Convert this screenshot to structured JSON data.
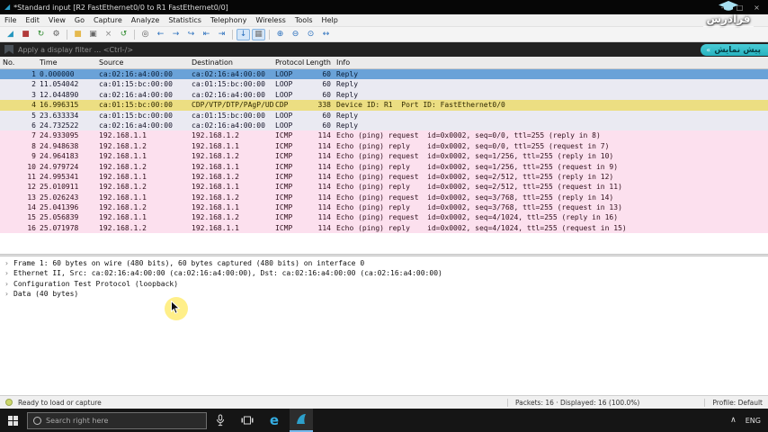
{
  "window": {
    "title": "*Standard input [R2 FastEthernet0/0 to R1 FastEthernet0/0]",
    "controls": [
      "–",
      "□",
      "×"
    ]
  },
  "menu": {
    "items": [
      "File",
      "Edit",
      "View",
      "Go",
      "Capture",
      "Analyze",
      "Statistics",
      "Telephony",
      "Wireless",
      "Tools",
      "Help"
    ]
  },
  "toolbar": {
    "icons": [
      {
        "name": "start-capture-icon",
        "glyph": "◢",
        "color": "#2596be"
      },
      {
        "name": "stop-capture-icon",
        "glyph": "■",
        "color": "#b23b3b"
      },
      {
        "name": "restart-capture-icon",
        "glyph": "↻",
        "color": "#2e8b2e"
      },
      {
        "name": "capture-options-icon",
        "glyph": "⚙",
        "color": "#5a5a5a"
      },
      {
        "sep": true
      },
      {
        "name": "open-file-icon",
        "glyph": "■",
        "color": "#e5b94e"
      },
      {
        "name": "save-file-icon",
        "glyph": "▣",
        "color": "#666666"
      },
      {
        "name": "close-file-icon",
        "glyph": "×",
        "color": "#888888"
      },
      {
        "name": "reload-file-icon",
        "glyph": "↺",
        "color": "#2e8b2e"
      },
      {
        "sep": true
      },
      {
        "name": "find-packet-icon",
        "glyph": "◎",
        "color": "#555555"
      },
      {
        "name": "back-icon",
        "glyph": "←",
        "color": "#2a6fbd"
      },
      {
        "name": "forward-icon",
        "glyph": "→",
        "color": "#2a6fbd"
      },
      {
        "name": "goto-packet-icon",
        "glyph": "↪",
        "color": "#2a6fbd"
      },
      {
        "name": "first-packet-icon",
        "glyph": "⇤",
        "color": "#2a6fbd"
      },
      {
        "name": "last-packet-icon",
        "glyph": "⇥",
        "color": "#2a6fbd"
      },
      {
        "sep": true
      },
      {
        "name": "auto-scroll-icon",
        "glyph": "↓",
        "color": "#2a6fbd",
        "active": true
      },
      {
        "name": "colorize-icon",
        "glyph": "▦",
        "color": "#777777",
        "active": true
      },
      {
        "sep": true
      },
      {
        "name": "zoom-in-icon",
        "glyph": "⊕",
        "color": "#2a6fbd"
      },
      {
        "name": "zoom-out-icon",
        "glyph": "⊖",
        "color": "#2a6fbd"
      },
      {
        "name": "zoom-reset-icon",
        "glyph": "⊙",
        "color": "#2a6fbd"
      },
      {
        "name": "resize-columns-icon",
        "glyph": "↔",
        "color": "#2a6fbd"
      }
    ]
  },
  "filter": {
    "placeholder": "Apply a display filter ... <Ctrl-/>"
  },
  "watermark": {
    "brand": "فرادرس",
    "badge": "پیش نمایش",
    "badge_mark": "«"
  },
  "packet_list": {
    "columns": [
      "No.",
      "Time",
      "Source",
      "Destination",
      "Protocol",
      "Length",
      "Info"
    ],
    "rows": [
      {
        "no": "1",
        "time": "0.000000",
        "source": "ca:02:16:a4:00:00",
        "destination": "ca:02:16:a4:00:00",
        "protocol": "LOOP",
        "length": "60",
        "info": "Reply",
        "type": "selected"
      },
      {
        "no": "2",
        "time": "11.054042",
        "source": "ca:01:15:bc:00:00",
        "destination": "ca:01:15:bc:00:00",
        "protocol": "LOOP",
        "length": "60",
        "info": "Reply",
        "type": "loop"
      },
      {
        "no": "3",
        "time": "12.044890",
        "source": "ca:02:16:a4:00:00",
        "destination": "ca:02:16:a4:00:00",
        "protocol": "LOOP",
        "length": "60",
        "info": "Reply",
        "type": "loop"
      },
      {
        "no": "4",
        "time": "16.996315",
        "source": "ca:01:15:bc:00:00",
        "destination": "CDP/VTP/DTP/PAgP/UD..",
        "protocol": "CDP",
        "length": "338",
        "info": "Device ID: R1  Port ID: FastEthernet0/0",
        "type": "cdp"
      },
      {
        "no": "5",
        "time": "23.633334",
        "source": "ca:01:15:bc:00:00",
        "destination": "ca:01:15:bc:00:00",
        "protocol": "LOOP",
        "length": "60",
        "info": "Reply",
        "type": "loop"
      },
      {
        "no": "6",
        "time": "24.732522",
        "source": "ca:02:16:a4:00:00",
        "destination": "ca:02:16:a4:00:00",
        "protocol": "LOOP",
        "length": "60",
        "info": "Reply",
        "type": "loop"
      },
      {
        "no": "7",
        "time": "24.933095",
        "source": "192.168.1.1",
        "destination": "192.168.1.2",
        "protocol": "ICMP",
        "length": "114",
        "info": "Echo (ping) request  id=0x0002, seq=0/0, ttl=255 (reply in 8)",
        "type": "icmp"
      },
      {
        "no": "8",
        "time": "24.948638",
        "source": "192.168.1.2",
        "destination": "192.168.1.1",
        "protocol": "ICMP",
        "length": "114",
        "info": "Echo (ping) reply    id=0x0002, seq=0/0, ttl=255 (request in 7)",
        "type": "icmp"
      },
      {
        "no": "9",
        "time": "24.964183",
        "source": "192.168.1.1",
        "destination": "192.168.1.2",
        "protocol": "ICMP",
        "length": "114",
        "info": "Echo (ping) request  id=0x0002, seq=1/256, ttl=255 (reply in 10)",
        "type": "icmp"
      },
      {
        "no": "10",
        "time": "24.979724",
        "source": "192.168.1.2",
        "destination": "192.168.1.1",
        "protocol": "ICMP",
        "length": "114",
        "info": "Echo (ping) reply    id=0x0002, seq=1/256, ttl=255 (request in 9)",
        "type": "icmp"
      },
      {
        "no": "11",
        "time": "24.995341",
        "source": "192.168.1.1",
        "destination": "192.168.1.2",
        "protocol": "ICMP",
        "length": "114",
        "info": "Echo (ping) request  id=0x0002, seq=2/512, ttl=255 (reply in 12)",
        "type": "icmp"
      },
      {
        "no": "12",
        "time": "25.010911",
        "source": "192.168.1.2",
        "destination": "192.168.1.1",
        "protocol": "ICMP",
        "length": "114",
        "info": "Echo (ping) reply    id=0x0002, seq=2/512, ttl=255 (request in 11)",
        "type": "icmp"
      },
      {
        "no": "13",
        "time": "25.026243",
        "source": "192.168.1.1",
        "destination": "192.168.1.2",
        "protocol": "ICMP",
        "length": "114",
        "info": "Echo (ping) request  id=0x0002, seq=3/768, ttl=255 (reply in 14)",
        "type": "icmp"
      },
      {
        "no": "14",
        "time": "25.041396",
        "source": "192.168.1.2",
        "destination": "192.168.1.1",
        "protocol": "ICMP",
        "length": "114",
        "info": "Echo (ping) reply    id=0x0002, seq=3/768, ttl=255 (request in 13)",
        "type": "icmp"
      },
      {
        "no": "15",
        "time": "25.056839",
        "source": "192.168.1.1",
        "destination": "192.168.1.2",
        "protocol": "ICMP",
        "length": "114",
        "info": "Echo (ping) request  id=0x0002, seq=4/1024, ttl=255 (reply in 16)",
        "type": "icmp"
      },
      {
        "no": "16",
        "time": "25.071978",
        "source": "192.168.1.2",
        "destination": "192.168.1.1",
        "protocol": "ICMP",
        "length": "114",
        "info": "Echo (ping) reply    id=0x0002, seq=4/1024, ttl=255 (request in 15)",
        "type": "icmp"
      }
    ]
  },
  "details": {
    "expander": "›",
    "lines": [
      "Frame 1: 60 bytes on wire (480 bits), 60 bytes captured (480 bits) on interface 0",
      "Ethernet II, Src: ca:02:16:a4:00:00 (ca:02:16:a4:00:00), Dst: ca:02:16:a4:00:00 (ca:02:16:a4:00:00)",
      "Configuration Test Protocol (loopback)",
      "Data (40 bytes)"
    ]
  },
  "status": {
    "ready_text": "Ready to load or capture",
    "packets_text": "Packets: 16 · Displayed: 16 (100.0%)",
    "profile_text": "Profile: Default"
  },
  "taskbar": {
    "search_placeholder": "Search right here",
    "browser_glyph": "e",
    "tray": {
      "chevron": "∧",
      "lang": "ENG"
    }
  },
  "colors": {
    "accent_blue": "#2b9ec9",
    "selected_row": "#6aa2d8",
    "cdp_row": "#ecde82",
    "icmp_row": "#fce0ee",
    "loop_row": "#eaeaf2",
    "badge_teal": "#2fbfca",
    "taskbar_bg": "#151515"
  }
}
